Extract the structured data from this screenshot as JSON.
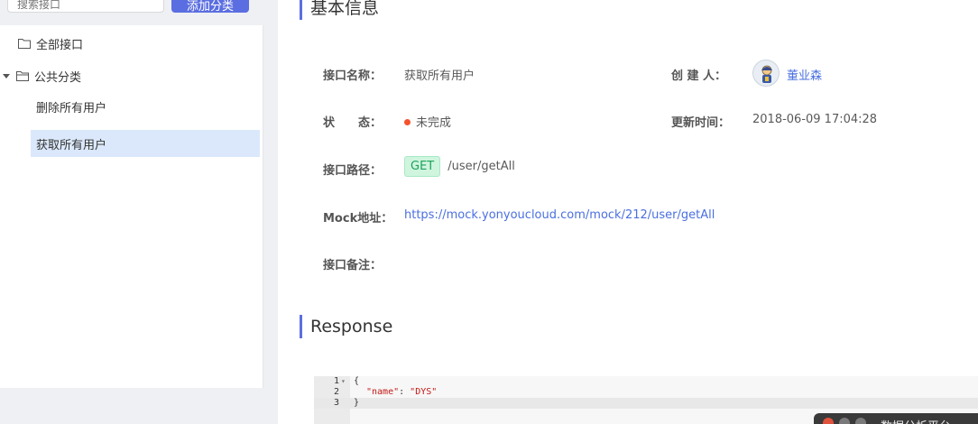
{
  "sidebar": {
    "search_placeholder": "搜索接口",
    "add_button": "添加分类",
    "tree": [
      {
        "label": "全部接口"
      },
      {
        "label": "公共分类"
      }
    ],
    "items": [
      {
        "label": "删除所有用户",
        "active": false
      },
      {
        "label": "获取所有用户",
        "active": true
      }
    ]
  },
  "main": {
    "basic_title": "基本信息",
    "labels": {
      "name": "接口名称：",
      "creator": "创 建 人：",
      "status": "状　　态：",
      "updated": "更新时间：",
      "path": "接口路径：",
      "mock": "Mock地址：",
      "remark": "接口备注："
    },
    "values": {
      "name": "获取所有用户",
      "creator": "董业森",
      "status": "未完成",
      "updated": "2018-06-09 17:04:28",
      "method": "GET",
      "path": "/user/getAll",
      "mock": "https://mock.yonyoucloud.com/mock/212/user/getAll"
    },
    "response_title": "Response",
    "code": {
      "lines": [
        {
          "num": "1",
          "text": "{"
        },
        {
          "num": "2",
          "key": "\"name\"",
          "sep": ": ",
          "val": "\"DYS\""
        },
        {
          "num": "3",
          "text": "}"
        }
      ]
    }
  },
  "overlay": {
    "title": "数据分析平台"
  },
  "colors": {
    "accent": "#5b6ee1",
    "link": "#4a6fe0",
    "status_dot": "#f5522d",
    "get_tag_bg": "#cff5df",
    "get_tag_text": "#1ea35a",
    "active_item": "#dbe8fb"
  }
}
